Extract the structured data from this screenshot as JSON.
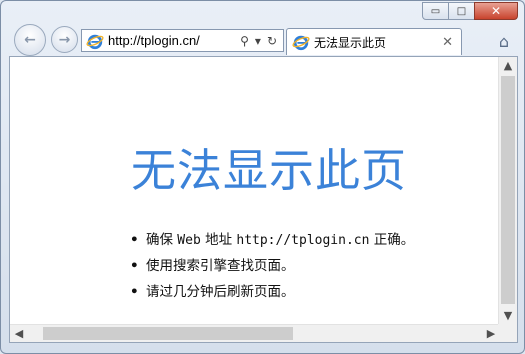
{
  "window": {
    "controls": {
      "minimize": "▭",
      "maximize": "□",
      "close": "✕"
    }
  },
  "nav": {
    "back_icon": "←",
    "forward_icon": "→"
  },
  "address_bar": {
    "url": "http://tplogin.cn/",
    "search_icon": "⚲",
    "dropdown_icon": "▾",
    "refresh_icon": "↻"
  },
  "tab": {
    "title": "无法显示此页",
    "close_icon": "✕"
  },
  "home_icon": "⌂",
  "page": {
    "heading": "无法显示此页",
    "items": [
      {
        "prefix": "确保 ",
        "mono1": "Web",
        "mid": " 地址 ",
        "mono2": "http://tplogin.cn",
        "suffix": " 正确。"
      },
      {
        "text": "使用搜索引擎查找页面。"
      },
      {
        "text": "请过几分钟后刷新页面。"
      }
    ],
    "bullet": "•"
  },
  "scrollbars": {
    "up": "▲",
    "down": "▼",
    "left": "◀",
    "right": "▶"
  },
  "colors": {
    "heading": "#3b82d8",
    "close_button": "#c8432d"
  }
}
